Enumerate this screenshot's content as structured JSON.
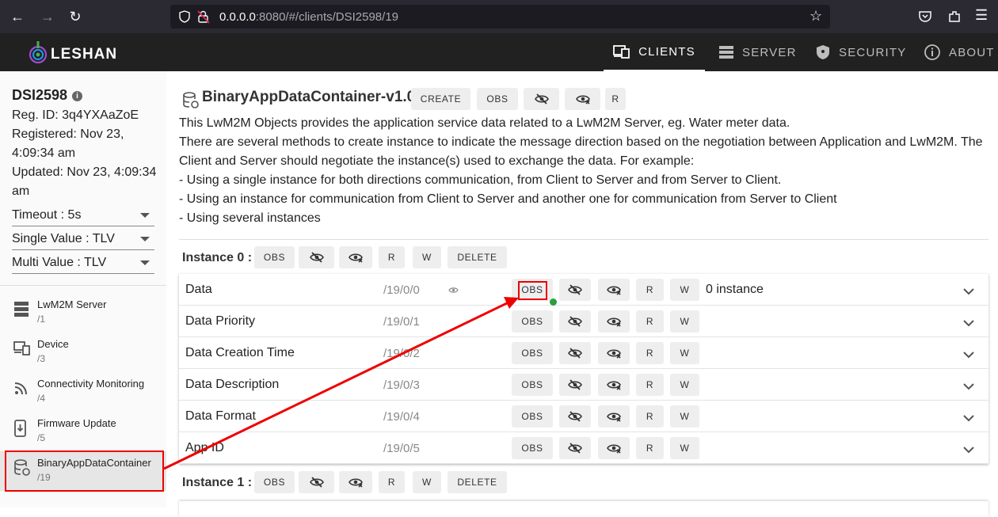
{
  "browser": {
    "url_host": "0.0.0.0",
    "url_rest": ":8080/#/clients/DSI2598/19"
  },
  "app": {
    "logo_text": "LESHAN",
    "tabs": [
      {
        "label": "CLIENTS",
        "icon": "clients-icon",
        "active": true
      },
      {
        "label": "SERVER",
        "icon": "server-icon",
        "active": false
      },
      {
        "label": "SECURITY",
        "icon": "shield-icon",
        "active": false
      },
      {
        "label": "ABOUT",
        "icon": "info-icon",
        "active": false
      }
    ]
  },
  "client": {
    "name": "DSI2598",
    "reg_id": "Reg. ID: 3q4YXAaZoE",
    "registered_1": "Registered: Nov 23,",
    "registered_2": "4:09:34 am",
    "updated_1": "Updated: Nov 23, 4:09:34",
    "updated_2": "am",
    "timeout": "Timeout : 5s",
    "single_value": "Single Value : TLV",
    "multi_value": "Multi Value : TLV"
  },
  "objects": [
    {
      "name": "LwM2M Server",
      "path": "/1",
      "icon": "server-icon"
    },
    {
      "name": "Device",
      "path": "/3",
      "icon": "devices-icon"
    },
    {
      "name": "Connectivity Monitoring",
      "path": "/4",
      "icon": "wifi-signal-icon"
    },
    {
      "name": "Firmware Update",
      "path": "/5",
      "icon": "system-update-icon"
    },
    {
      "name": "BinaryAppDataContainer",
      "path": "/19",
      "icon": "database-sync-icon",
      "selected": true
    }
  ],
  "object": {
    "title": "BinaryAppDataContainer-v1.0",
    "create_label": "CREATE",
    "obs_label": "OBS",
    "r_label": "R",
    "description": [
      "This LwM2M Objects provides the application service data related to a LwM2M Server, eg. Water meter data.",
      "There are several methods to create instance to indicate the message direction based on the negotiation between Application and LwM2M. The",
      "Client and Server should negotiate the instance(s) used to exchange the data. For example:",
      " - Using a single instance for both directions communication, from Client to Server and from Server to Client.",
      " - Using an instance for communication from Client to Server and another one for communication from Server to Client",
      " - Using several instances"
    ]
  },
  "instances": [
    {
      "label": "Instance 0 :",
      "obs": "OBS",
      "r": "R",
      "w": "W",
      "delete": "DELETE"
    },
    {
      "label": "Instance 1 :",
      "obs": "OBS",
      "r": "R",
      "w": "W",
      "delete": "DELETE"
    }
  ],
  "resources": [
    {
      "name": "Data",
      "path": "/19/0/0",
      "value": "0 instance",
      "observed": true
    },
    {
      "name": "Data Priority",
      "path": "/19/0/1",
      "value": ""
    },
    {
      "name": "Data Creation Time",
      "path": "/19/0/2",
      "value": ""
    },
    {
      "name": "Data Description",
      "path": "/19/0/3",
      "value": ""
    },
    {
      "name": "Data Format",
      "path": "/19/0/4",
      "value": ""
    },
    {
      "name": "App ID",
      "path": "/19/0/5",
      "value": ""
    }
  ],
  "resource_buttons": {
    "obs": "OBS",
    "r": "R",
    "w": "W"
  },
  "annotation_color": "#e00000"
}
